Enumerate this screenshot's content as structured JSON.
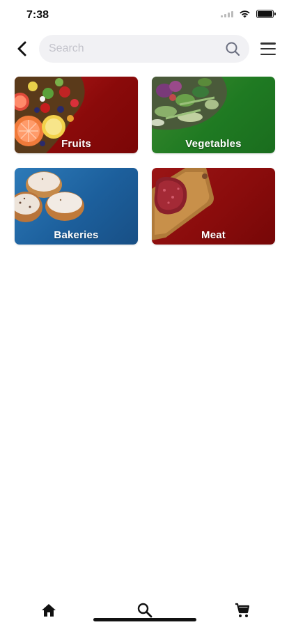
{
  "status_bar": {
    "time": "7:38",
    "icons": [
      "cellular-signal-icon",
      "wifi-icon",
      "battery-icon"
    ]
  },
  "header": {
    "back_icon": "chevron-left-icon",
    "search": {
      "placeholder": "Search",
      "value": "",
      "icon": "search-icon"
    },
    "menu_icon": "hamburger-menu-icon"
  },
  "categories": [
    {
      "label": "Fruits",
      "color": "#8a0a0a"
    },
    {
      "label": "Vegetables",
      "color": "#1f7a22"
    },
    {
      "label": "Bakeries",
      "color": "#1c5f9c"
    },
    {
      "label": "Meat",
      "color": "#8a0c0c"
    }
  ],
  "bottom_nav": {
    "items": [
      {
        "name": "home",
        "icon": "home-icon"
      },
      {
        "name": "search",
        "icon": "search-icon"
      },
      {
        "name": "cart",
        "icon": "cart-icon"
      }
    ]
  }
}
